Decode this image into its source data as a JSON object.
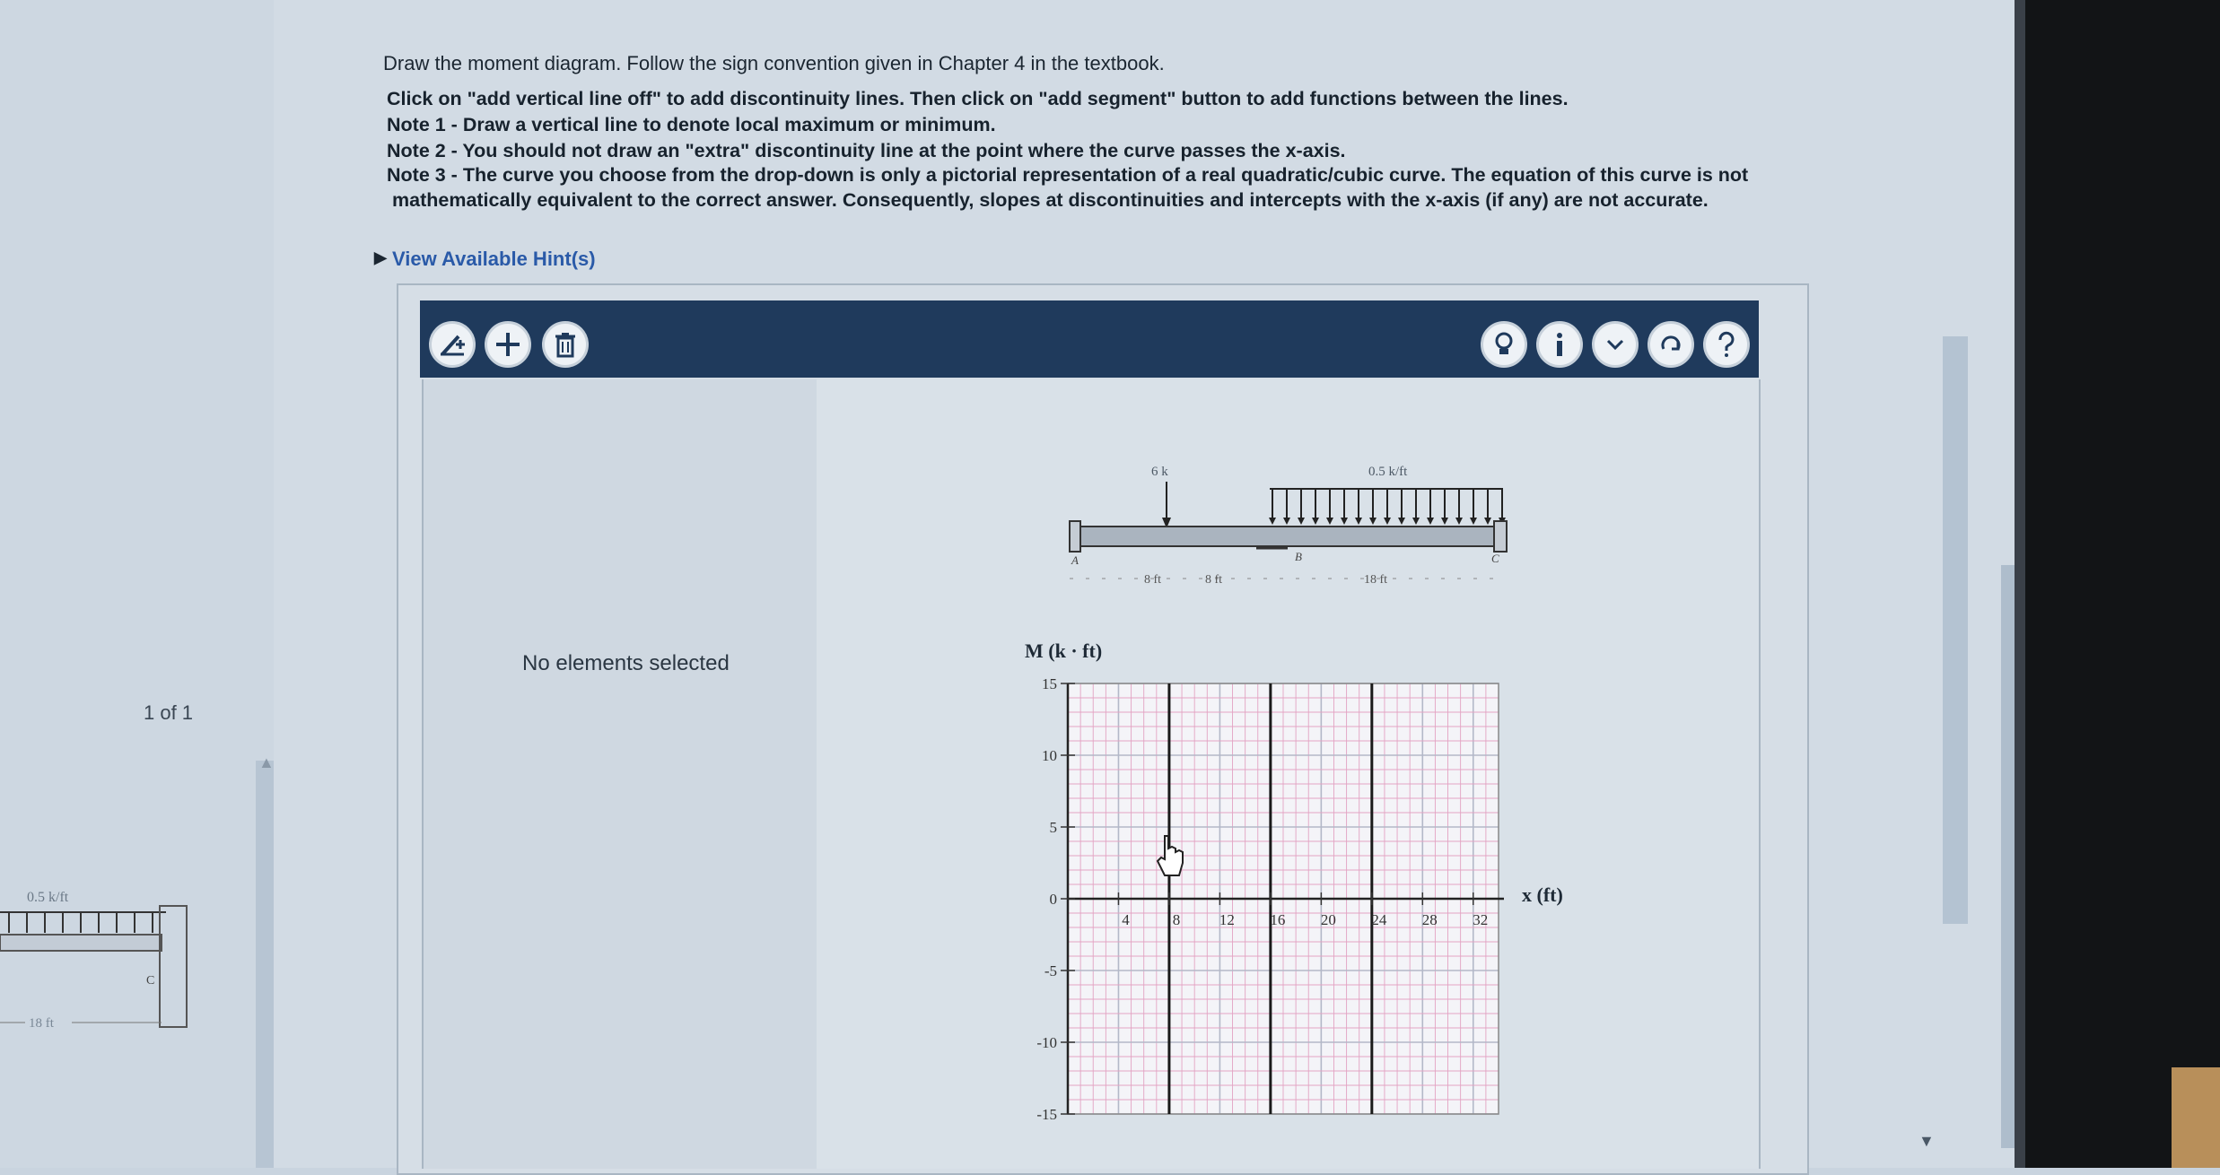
{
  "question": {
    "title": "Draw the moment diagram. Follow the sign convention given in Chapter 4 in the textbook.",
    "instructions": [
      "Click on \"add vertical line off\" to add discontinuity lines. Then click on \"add segment\" button to add functions between the lines.",
      "Note 1 - Draw a vertical line to denote local maximum or minimum.",
      "Note 2 - You should not draw an \"extra\" discontinuity line at the point where the curve passes the x-axis.",
      "Note 3 - The curve you choose from the drop-down is only a pictorial representation of a real quadratic/cubic curve. The equation of this curve is not",
      "mathematically equivalent to the correct answer. Consequently, slopes at discontinuities and intercepts with the x-axis (if any) are not accurate."
    ],
    "hint_link": "View Available Hint(s)"
  },
  "left_panel": {
    "pager": "1 of 1",
    "thumb_load": "0.5 k/ft",
    "thumb_span": "18 ft",
    "thumb_support": "C"
  },
  "toolbar": {
    "left_icons": [
      "add-vertical-line-icon",
      "add-segment-icon",
      "trash-icon"
    ],
    "right_icons": [
      "lightbulb-icon",
      "info-icon",
      "chevron-down-icon",
      "reset-icon",
      "help-icon"
    ]
  },
  "side_panel": {
    "status": "No elements selected"
  },
  "beam": {
    "point_load": "6 k",
    "dist_load": "0.5 k/ft",
    "label_a": "A",
    "label_b": "B",
    "label_c": "C",
    "dim_1": "8 ft",
    "dim_2": "8 ft",
    "dim_3": "18 ft"
  },
  "graph": {
    "y_label": "M (k · ft)",
    "x_label": "x (ft)",
    "y_ticks": [
      "15",
      "10",
      "5",
      "0",
      "-5",
      "-10",
      "-15"
    ],
    "x_ticks": [
      "4",
      "8",
      "12",
      "16",
      "20",
      "24",
      "28",
      "32"
    ],
    "x_max": 34,
    "y_min": -15,
    "y_max": 15,
    "discontinuity_lines_x": [
      8,
      16,
      24
    ],
    "colors": {
      "grid_minor": "#e3a3c3",
      "grid_major": "#b3b8c8",
      "axis": "#222222"
    }
  }
}
